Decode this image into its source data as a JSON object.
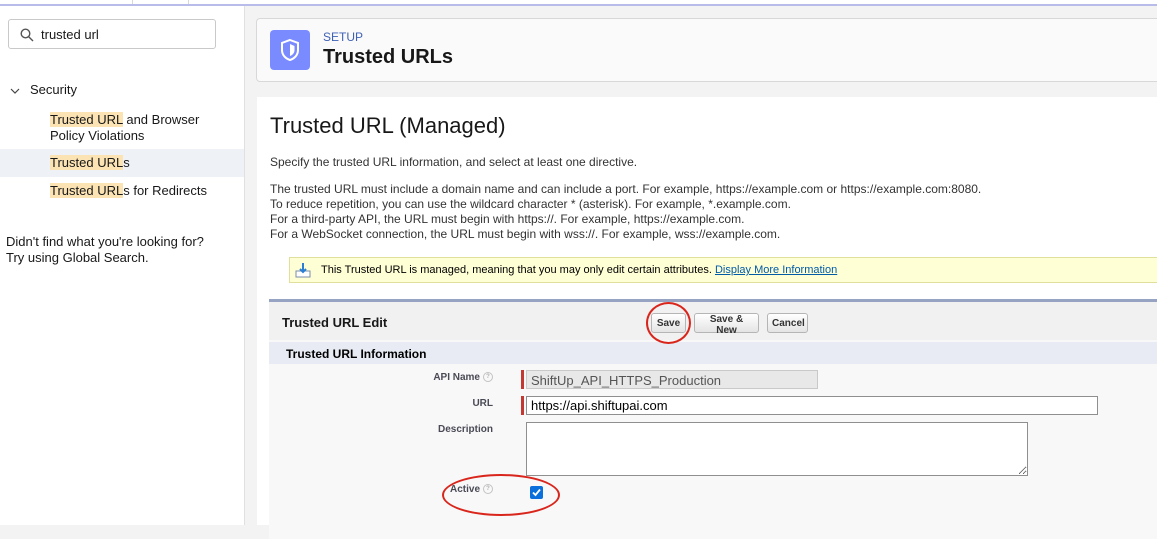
{
  "search": {
    "value": "trusted url"
  },
  "sidebar": {
    "section": "Security",
    "items": [
      {
        "highlight": "Trusted URL",
        "rest": " and Browser",
        "line2": "Policy Violations"
      },
      {
        "highlight": "Trusted URL",
        "rest": "s"
      },
      {
        "highlight": "Trusted URL",
        "rest": "s for Redirects"
      }
    ],
    "help_line1": "Didn't find what you're looking for?",
    "help_line2": "Try using Global Search."
  },
  "header": {
    "eyebrow": "SETUP",
    "title": "Trusted URLs"
  },
  "page": {
    "title": "Trusted URL (Managed)",
    "intro": "Specify the trusted URL information, and select at least one directive.",
    "rules": [
      "The trusted URL must include a domain name and can include a port. For example, https://example.com or https://example.com:8080.",
      "To reduce repetition, you can use the wildcard character * (asterisk). For example, *.example.com.",
      "For a third-party API, the URL must begin with https://. For example, https://example.com.",
      "For a WebSocket connection, the URL must begin with wss://. For example, wss://example.com."
    ]
  },
  "notice": {
    "text": "This Trusted URL is managed, meaning that you may only edit certain attributes.",
    "link": "Display More Information"
  },
  "edit": {
    "title": "Trusted URL Edit",
    "save": "Save",
    "save_new": "Save & New",
    "cancel": "Cancel",
    "section": "Trusted URL Information",
    "api_name_label": "API Name",
    "api_name_value": "ShiftUp_API_HTTPS_Production",
    "url_label": "URL",
    "url_value": "https://api.shiftupai.com",
    "description_label": "Description",
    "active_label": "Active",
    "active_checked": true
  },
  "colors": {
    "accent": "#7a8bff",
    "annotation": "#d9261c",
    "checkbox": "#0b6fdc"
  }
}
